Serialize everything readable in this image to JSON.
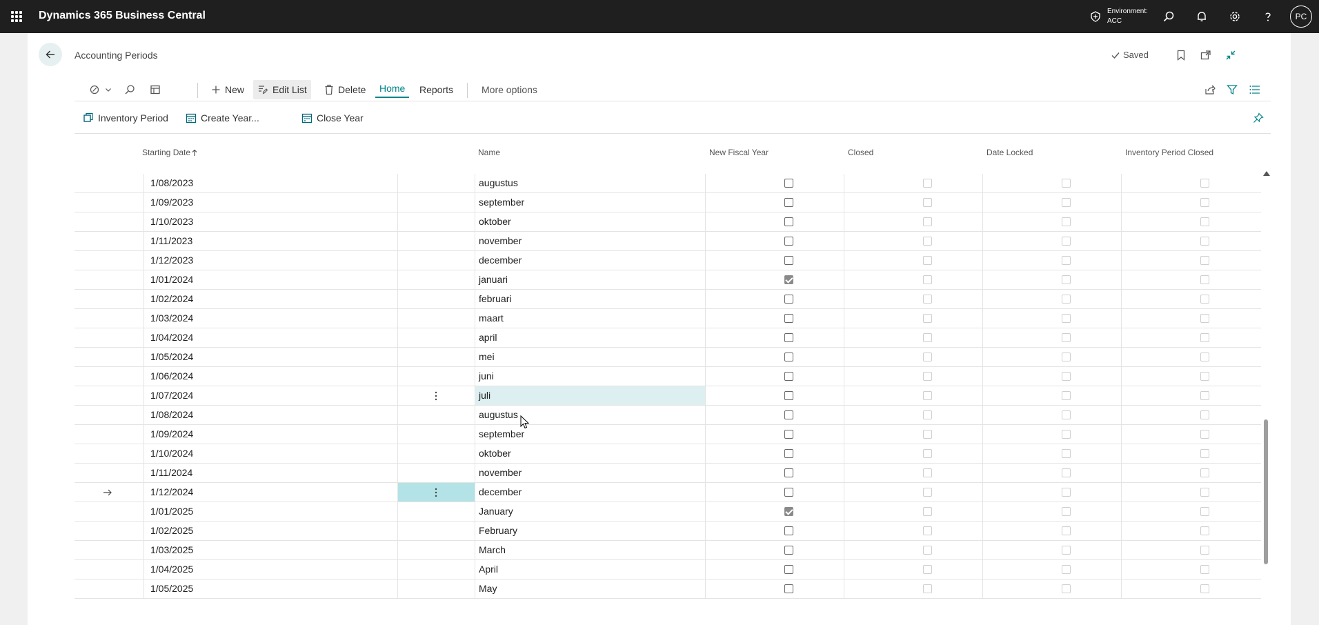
{
  "app": {
    "title": "Dynamics 365 Business Central",
    "environment_label": "Environment:",
    "environment_value": "ACC",
    "user_initials": "PC"
  },
  "page": {
    "title": "Accounting Periods",
    "saved_label": "Saved"
  },
  "actions": {
    "new_label": "New",
    "edit_list_label": "Edit List",
    "delete_label": "Delete",
    "home_label": "Home",
    "reports_label": "Reports",
    "more_options_label": "More options",
    "inventory_period_label": "Inventory Period",
    "create_year_label": "Create Year...",
    "close_year_label": "Close Year"
  },
  "columns": {
    "starting_date": "Starting Date",
    "name": "Name",
    "new_fiscal_year": "New Fiscal Year",
    "closed": "Closed",
    "date_locked": "Date Locked",
    "inventory_period_closed": "Inventory Period Closed"
  },
  "colors": {
    "accent": "#008489",
    "selected_row": "#ddeff0",
    "selected_cell": "#b3e3e6",
    "appbar": "#1f1f1f"
  },
  "rows": [
    {
      "date": "1/08/2023",
      "name": "augustus",
      "new_fiscal_year": false
    },
    {
      "date": "1/09/2023",
      "name": "september",
      "new_fiscal_year": false
    },
    {
      "date": "1/10/2023",
      "name": "oktober",
      "new_fiscal_year": false
    },
    {
      "date": "1/11/2023",
      "name": "november",
      "new_fiscal_year": false
    },
    {
      "date": "1/12/2023",
      "name": "december",
      "new_fiscal_year": false
    },
    {
      "date": "1/01/2024",
      "name": "januari",
      "new_fiscal_year": true
    },
    {
      "date": "1/02/2024",
      "name": "februari",
      "new_fiscal_year": false
    },
    {
      "date": "1/03/2024",
      "name": "maart",
      "new_fiscal_year": false
    },
    {
      "date": "1/04/2024",
      "name": "april",
      "new_fiscal_year": false
    },
    {
      "date": "1/05/2024",
      "name": "mei",
      "new_fiscal_year": false
    },
    {
      "date": "1/06/2024",
      "name": "juni",
      "new_fiscal_year": false
    },
    {
      "date": "1/07/2024",
      "name": "juli",
      "new_fiscal_year": false,
      "hover": true
    },
    {
      "date": "1/08/2024",
      "name": "augustus",
      "new_fiscal_year": false
    },
    {
      "date": "1/09/2024",
      "name": "september",
      "new_fiscal_year": false
    },
    {
      "date": "1/10/2024",
      "name": "oktober",
      "new_fiscal_year": false
    },
    {
      "date": "1/11/2024",
      "name": "november",
      "new_fiscal_year": false
    },
    {
      "date": "1/12/2024",
      "name": "december",
      "new_fiscal_year": false,
      "current": true
    },
    {
      "date": "1/01/2025",
      "name": "January",
      "new_fiscal_year": true
    },
    {
      "date": "1/02/2025",
      "name": "February",
      "new_fiscal_year": false
    },
    {
      "date": "1/03/2025",
      "name": "March",
      "new_fiscal_year": false
    },
    {
      "date": "1/04/2025",
      "name": "April",
      "new_fiscal_year": false
    },
    {
      "date": "1/05/2025",
      "name": "May",
      "new_fiscal_year": false
    }
  ]
}
